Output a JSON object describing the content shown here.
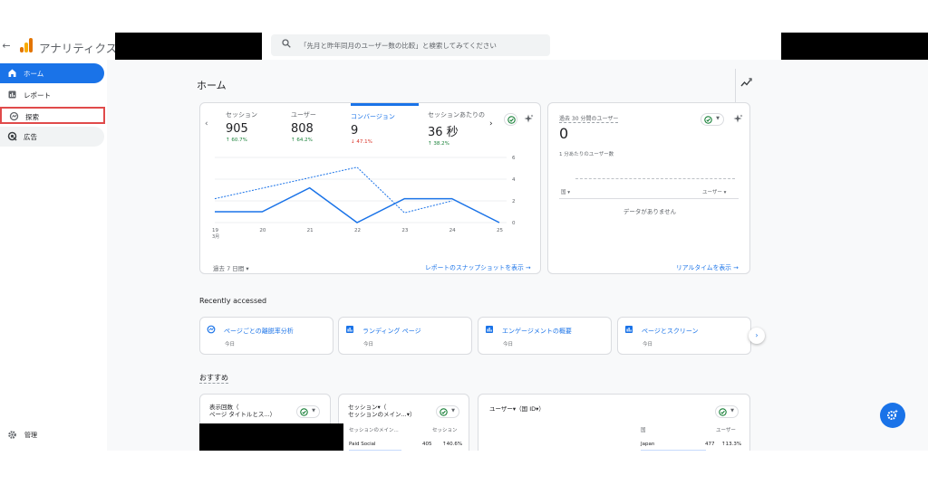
{
  "app": {
    "name": "アナリティクス"
  },
  "search": {
    "placeholder": "「先月と昨年同月のユーザー数の比較」と検索してみてください"
  },
  "sidebar": {
    "items": [
      {
        "label": "ホーム",
        "icon": "home-icon"
      },
      {
        "label": "レポート",
        "icon": "reports-icon"
      },
      {
        "label": "探索",
        "icon": "explore-icon"
      },
      {
        "label": "広告",
        "icon": "ads-icon"
      }
    ],
    "admin_label": "管理"
  },
  "page": {
    "title": "ホーム"
  },
  "metrics": [
    {
      "label": "セッション",
      "value": "905",
      "change": "60.7%",
      "direction": "up"
    },
    {
      "label": "ユーザー",
      "value": "808",
      "change": "64.2%",
      "direction": "up"
    },
    {
      "label": "コンバージョン",
      "value": "9",
      "change": "47.1%",
      "direction": "down"
    },
    {
      "label": "セッションあたりの",
      "value": "36 秒",
      "change": "38.2%",
      "direction": "up"
    }
  ],
  "chart_data": {
    "type": "line",
    "x": [
      "19",
      "20",
      "21",
      "22",
      "23",
      "24",
      "25"
    ],
    "x_sublabel": "3月",
    "series": [
      {
        "name": "過去 7 日間",
        "style": "solid",
        "values": [
          1,
          1,
          3.2,
          0,
          2.2,
          2.2,
          0
        ]
      },
      {
        "name": "前の期間",
        "style": "dashed",
        "values": [
          2.2,
          null,
          null,
          5.1,
          0.9,
          2,
          null
        ]
      }
    ],
    "ylim": [
      0,
      6
    ],
    "yticks": [
      "0",
      "2",
      "4",
      "6"
    ],
    "legend_placement": "bottom-left",
    "colors": {
      "line": "#1a73e8"
    }
  },
  "main_card": {
    "range_label": "過去 7 日間",
    "snapshot_link": "レポートのスナップショットを表示"
  },
  "realtime": {
    "title": "過去 30 分間のユーザー",
    "value": "0",
    "subtitle": "1 分あたりのユーザー数",
    "col_left": "国",
    "col_right": "ユーザー",
    "no_data": "データがありません",
    "link": "リアルタイムを表示"
  },
  "recent": {
    "title": "Recently accessed",
    "items": [
      {
        "name": "ページごとの離脱率分析",
        "date": "今日",
        "icon": "explore-icon"
      },
      {
        "name": "ランディング ページ",
        "date": "今日",
        "icon": "report-icon"
      },
      {
        "name": "エンゲージメントの概要",
        "date": "今日",
        "icon": "report-icon"
      },
      {
        "name": "ページとスクリーン",
        "date": "今日",
        "icon": "report-icon"
      }
    ]
  },
  "recommended": {
    "title": "おすすめ",
    "cards": [
      {
        "heading_1": "表示回数（",
        "heading_2": "ページ タイトルとス...）"
      },
      {
        "heading_1": "セッション▾（",
        "heading_2": "セッションのメイン...▾）",
        "col_left": "セッションのメイン...",
        "col_right": "セッション",
        "row_label": "Paid Social",
        "row_value": "405",
        "row_change": "40.6%"
      },
      {
        "heading": "ユーザー▾（国 ID▾）",
        "col_left": "国",
        "col_right": "ユーザー",
        "row_label": "Japan",
        "row_value": "477",
        "row_change": "13.3%"
      }
    ]
  },
  "colors": {
    "accent": "#1a73e8",
    "up": "#188038",
    "down": "#d93025",
    "highlight_box": "#e04a4a"
  }
}
